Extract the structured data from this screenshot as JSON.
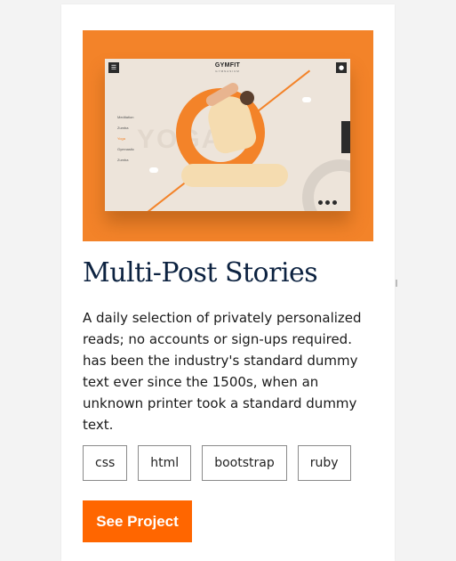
{
  "card": {
    "image": {
      "brand": "GYMFIT",
      "brand_sub": "GYMNASIUM",
      "big_word": "YOGA",
      "menu": [
        "Meditation",
        "Zumba",
        "Yoga",
        "Gymnastic",
        "Zumba"
      ],
      "side_tab_label": "Learn More",
      "background_color": "#f38329"
    },
    "title": "Multi-Post Stories",
    "description": "A daily selection of privately personalized reads; no accounts or sign-ups required. has been the industry's standard dummy text ever since the 1500s, when an unknown printer took a standard dummy text.",
    "tags": [
      "css",
      "html",
      "bootstrap",
      "ruby"
    ],
    "cta_label": "See Project",
    "accent_color": "#ff6600",
    "title_color": "#0c2240"
  }
}
